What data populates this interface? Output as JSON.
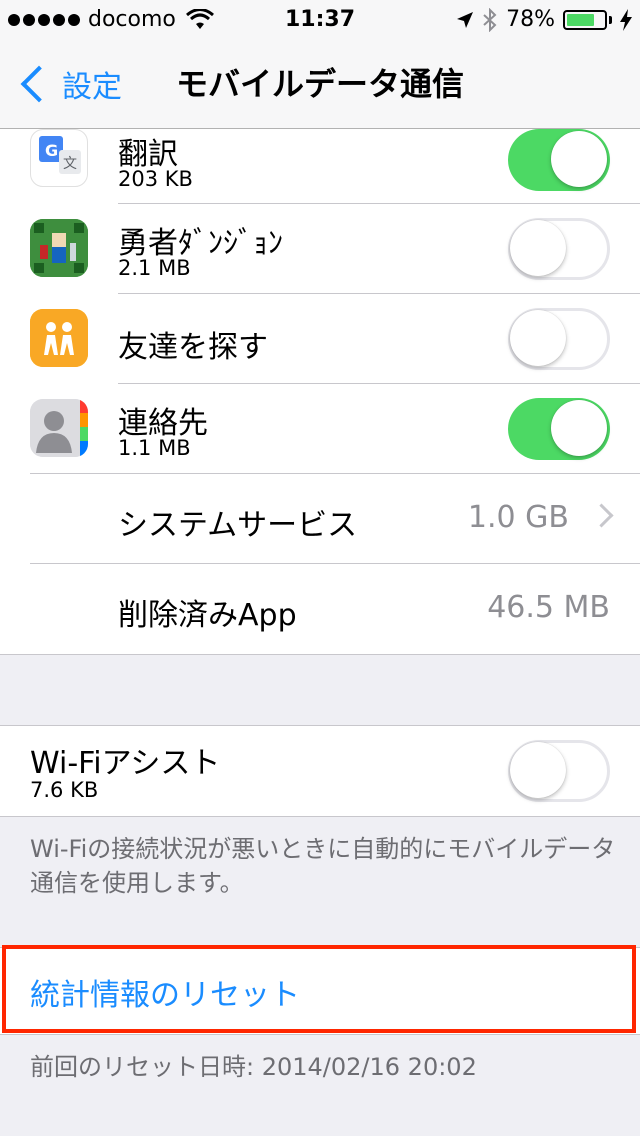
{
  "status_bar": {
    "carrier": "docomo",
    "time": "11:37",
    "battery_percent": "78%",
    "battery_level": 0.78,
    "icons": [
      "signal-dots-icon",
      "wifi-icon",
      "location-arrow-icon",
      "bluetooth-icon",
      "battery-icon",
      "charging-bolt-icon"
    ]
  },
  "nav": {
    "back_label": "設定",
    "title": "モバイルデータ通信"
  },
  "apps": [
    {
      "name": "翻訳",
      "usage": "203 KB",
      "enabled": true,
      "icon": "google-translate-icon"
    },
    {
      "name": "勇者ﾀﾞﾝｼﾞｮﾝ",
      "usage": "2.1 MB",
      "enabled": false,
      "icon": "game-icon"
    },
    {
      "name": "友達を探す",
      "usage": "",
      "enabled": false,
      "icon": "find-friends-icon"
    },
    {
      "name": "連絡先",
      "usage": "1.1 MB",
      "enabled": true,
      "icon": "contacts-icon"
    }
  ],
  "system_services": {
    "label": "システムサービス",
    "value": "1.0 GB"
  },
  "deleted_apps": {
    "label": "削除済みApp",
    "value": "46.5 MB"
  },
  "wifi_assist": {
    "label": "Wi-Fiアシスト",
    "usage": "7.6 KB",
    "enabled": false,
    "description": "Wi-Fiの接続状況が悪いときに自動的にモバイルデータ通信を使用します。"
  },
  "reset": {
    "label": "統計情報のリセット",
    "last_reset": "前回のリセット日時: 2014/02/16 20:02"
  },
  "colors": {
    "accent": "#1a8cff",
    "toggle_on": "#4cd964",
    "highlight_box": "#ff2600",
    "background": "#efeff4"
  }
}
